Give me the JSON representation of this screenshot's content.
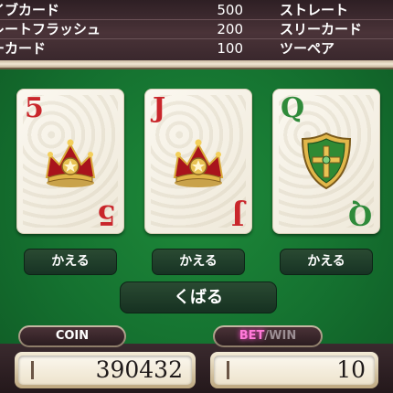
{
  "paytable": {
    "rows": [
      {
        "hand": "イブカード",
        "value": "500",
        "right_hand": "ストレート"
      },
      {
        "hand": "レートフラッシュ",
        "value": "200",
        "right_hand": "スリーカード"
      },
      {
        "hand": "ーカード",
        "value": "100",
        "right_hand": "ツーペア"
      }
    ]
  },
  "cards": [
    {
      "rank": "5",
      "color": "red",
      "emblem": "crown-emblem"
    },
    {
      "rank": "J",
      "color": "red",
      "emblem": "crown-emblem"
    },
    {
      "rank": "Q",
      "color": "green",
      "emblem": "shield-emblem"
    }
  ],
  "buttons": {
    "change_label": "かえる",
    "deal_label": "くばる"
  },
  "coin": {
    "label": "COIN",
    "value": "390432"
  },
  "bet_win": {
    "bet_label": "BET",
    "divider": "/",
    "win_label": "WIN",
    "value": "10"
  },
  "colors": {
    "felt": "#157230",
    "rank_red": "#c9262b",
    "rank_green": "#2f8a3a",
    "bet_active": "#ff7ad8"
  }
}
